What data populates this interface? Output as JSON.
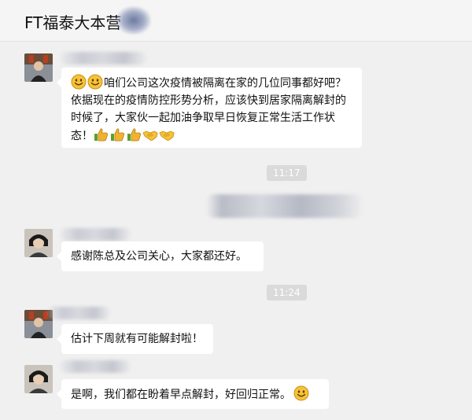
{
  "chat": {
    "title": "FT福泰大本营"
  },
  "messages": [
    {
      "text": "咱们公司这次疫情被隔离在家的几位同事都好吧？依据现在的疫情防控形势分析，应该快到居家隔离解封的时候了，大家伙一起加油争取早日恢复正常生活工作状态！",
      "leading_emojis": [
        "smile-emoji",
        "smile-emoji"
      ],
      "trailing_emojis": [
        "thumbs-up-emoji",
        "thumbs-up-emoji",
        "thumbs-up-emoji",
        "handshake-emoji",
        "handshake-emoji"
      ]
    },
    {
      "text": "感谢陈总及公司关心，大家都还好。"
    },
    {
      "text": "估计下周就有可能解封啦！"
    },
    {
      "text": "是啊，我们都在盼着早点解封，好回归正常。",
      "trailing_emojis": [
        "smile-emoji"
      ]
    }
  ],
  "timestamps": [
    "11:17",
    "11:24"
  ],
  "colors": {
    "background": "#f0f0f0",
    "bubble": "#ffffff",
    "time_badge": "#dadada",
    "thumbs": "#5a9e2f",
    "emoji_yellow": "#f6c338"
  }
}
